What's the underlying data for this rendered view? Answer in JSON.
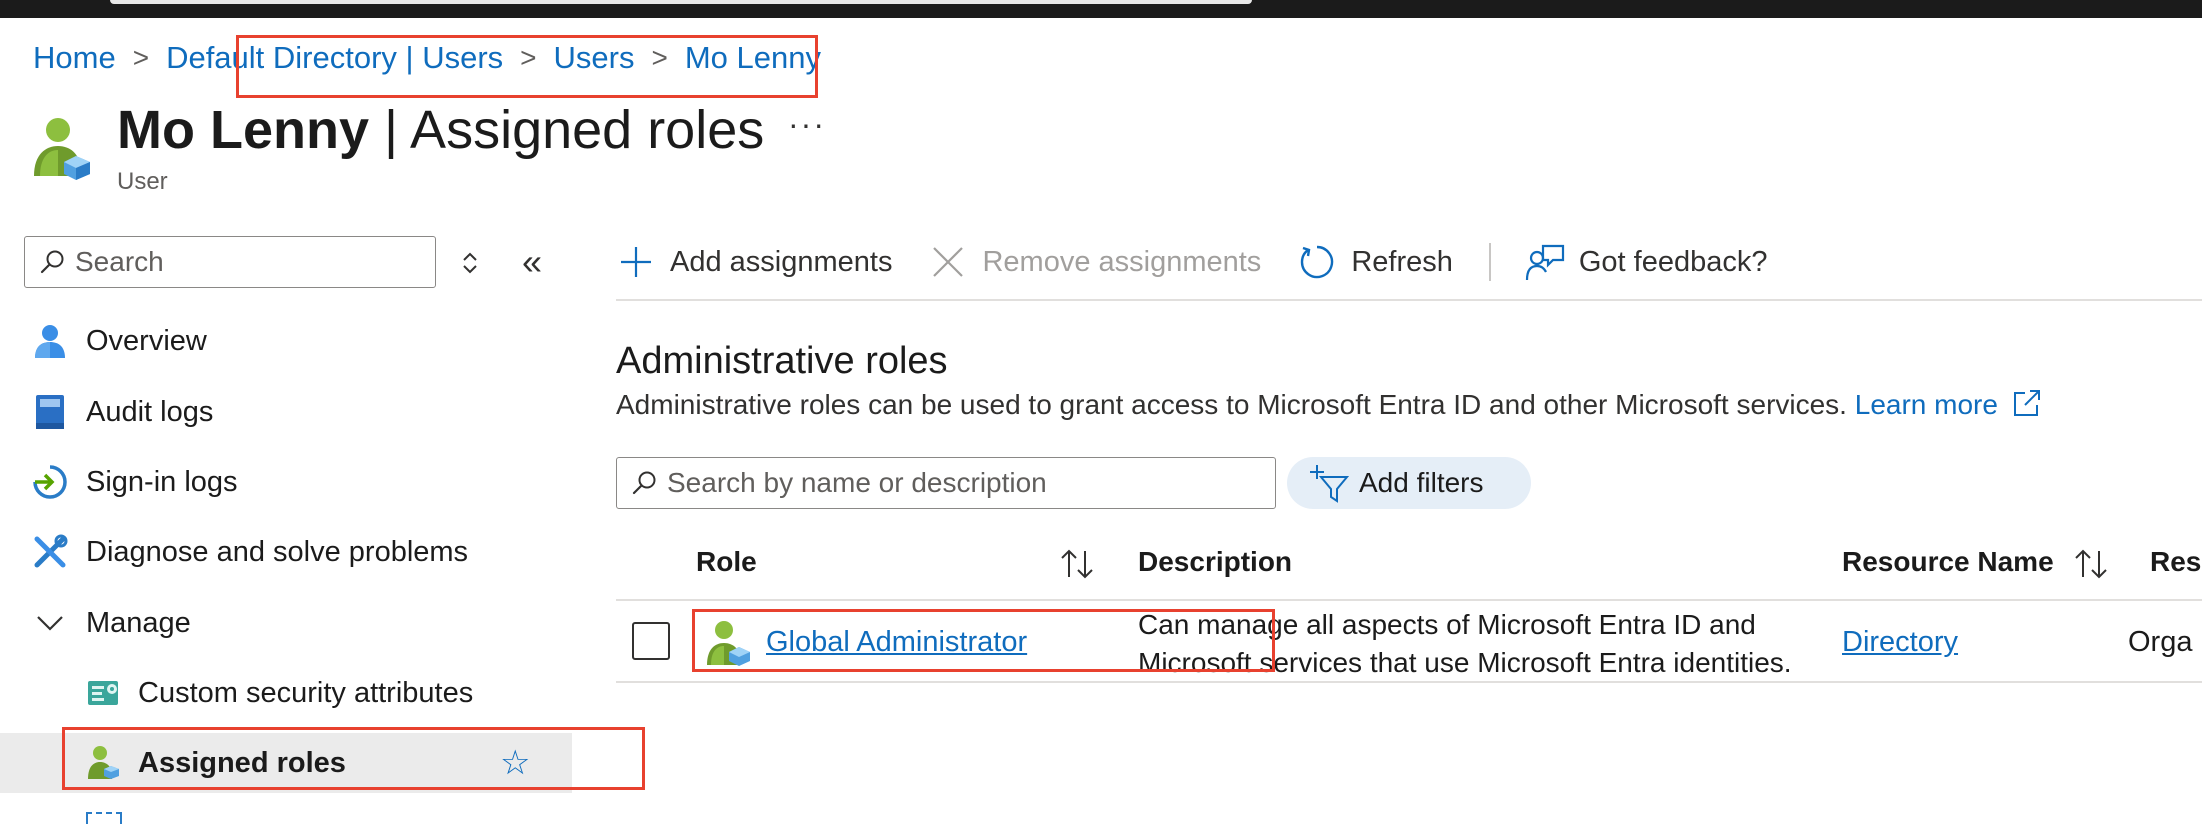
{
  "breadcrumb": [
    "Home",
    "Default Directory | Users",
    "Users",
    "Mo Lenny"
  ],
  "page": {
    "title_bold": "Mo Lenny",
    "title_rest": " | Assigned roles",
    "more": "···",
    "subtitle": "User"
  },
  "sidebar": {
    "search_placeholder": "Search",
    "collapse_glyph": "«",
    "items": [
      {
        "label": "Overview",
        "icon": "user-icon"
      },
      {
        "label": "Audit logs",
        "icon": "book-icon"
      },
      {
        "label": "Sign-in logs",
        "icon": "sign-in-icon"
      },
      {
        "label": "Diagnose and solve problems",
        "icon": "wrench-icon"
      },
      {
        "label": "Manage",
        "icon": "chevron-down-icon"
      },
      {
        "label": "Custom security attributes",
        "icon": "attributes-icon"
      },
      {
        "label": "Assigned roles",
        "icon": "user-role-icon",
        "active": true
      }
    ]
  },
  "toolbar": {
    "add": "Add assignments",
    "remove": "Remove assignments",
    "refresh": "Refresh",
    "feedback": "Got feedback?"
  },
  "section": {
    "title": "Administrative roles",
    "description": "Administrative roles can be used to grant access to Microsoft Entra ID and other Microsoft services.",
    "learn_more": "Learn more"
  },
  "table": {
    "search_placeholder": "Search by name or description",
    "filter_label": "Add filters",
    "columns": [
      "Role",
      "Description",
      "Resource Name",
      "Reso"
    ],
    "rows": [
      {
        "role": "Global Administrator",
        "description_line1": "Can manage all aspects of Microsoft Entra ID and",
        "description_line2": "Microsoft services that use Microsoft Entra identities.",
        "resource_name": "Directory",
        "resource_type": "Orga"
      }
    ]
  },
  "colors": {
    "link": "#0f6cbd",
    "highlight": "#e8412f",
    "active_bg": "#ebebeb",
    "filter_bg": "#e5eef7"
  }
}
